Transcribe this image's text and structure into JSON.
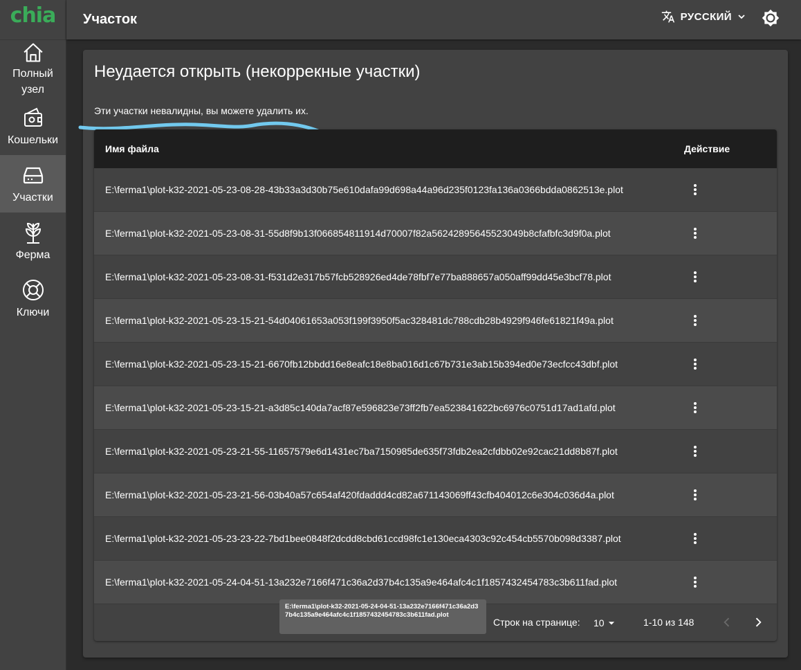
{
  "app": {
    "logo": "chia"
  },
  "sidebar": {
    "items": [
      {
        "label": "Полный узел",
        "icon": "home-icon"
      },
      {
        "label": "Кошельки",
        "icon": "wallet-icon"
      },
      {
        "label": "Участки",
        "icon": "hard-drive-icon",
        "active": true
      },
      {
        "label": "Ферма",
        "icon": "sprout-icon"
      },
      {
        "label": "Ключи",
        "icon": "lifebuoy-icon"
      }
    ]
  },
  "header": {
    "title": "Участок",
    "language": "РУССКИЙ",
    "language_icon": "translate-icon",
    "theme_icon": "brightness-icon"
  },
  "card": {
    "title": "Неудается открыть (некоррекные участки)",
    "subtitle": "Эти участки невалидны, вы можете удалить их."
  },
  "table": {
    "columns": [
      "Имя файла",
      "Действие"
    ],
    "rows": [
      "E:\\ferma1\\plot-k32-2021-05-23-08-28-43b33a3d30b75e610dafa99d698a44a96d235f0123fa136a0366bdda0862513e.plot",
      "E:\\ferma1\\plot-k32-2021-05-23-08-31-55d8f9b13f066854811914d70007f82a56242895645523049b8cfafbfc3d9f0a.plot",
      "E:\\ferma1\\plot-k32-2021-05-23-08-31-f531d2e317b57fcb528926ed4de78fbf7e77ba888657a050aff99dd45e3bcf78.plot",
      "E:\\ferma1\\plot-k32-2021-05-23-15-21-54d04061653a053f199f3950f5ac328481dc788cdb28b4929f946fe61821f49a.plot",
      "E:\\ferma1\\plot-k32-2021-05-23-15-21-6670fb12bbdd16e8eafc18e8ba016d1c67b731e3ab15b394ed0e73ecfcc43dbf.plot",
      "E:\\ferma1\\plot-k32-2021-05-23-15-21-a3d85c140da7acf87e596823e73ff2fb7ea523841622bc6976c0751d17ad1afd.plot",
      "E:\\ferma1\\plot-k32-2021-05-23-21-55-11657579e6d1431ec7ba7150985de635f73fdb2ea2cfdbb02e92cac21dd8b87f.plot",
      "E:\\ferma1\\plot-k32-2021-05-23-21-56-03b40a57c654af420fdaddd4cd82a671143069ff43cfb404012c6e304c036d4a.plot",
      "E:\\ferma1\\plot-k32-2021-05-23-23-22-7bd1bee0848f2dcdd8cbd61ccd98fc1e130eca4303c92c454cb5570b098d3387.plot",
      "E:\\ferma1\\plot-k32-2021-05-24-04-51-13a232e7166f471c36a2d37b4c135a9e464afc4c1f1857432454783c3b611fad.plot"
    ],
    "row_action_icon": "more-vertical-icon"
  },
  "pagination": {
    "rows_per_page_label": "Строк на странице:",
    "rows_per_page_value": "10",
    "range_text": "1-10 из 148"
  },
  "tooltip": {
    "text": "E:\\ferma1\\plot-k32-2021-05-24-04-51-13a232e7166f471c36a2d37b4c135a9e464afc4c1f1857432454783c3b611fad.plot"
  },
  "colors": {
    "brand_green": "#3aac59",
    "highlight_scribble": "#72c9ee"
  }
}
